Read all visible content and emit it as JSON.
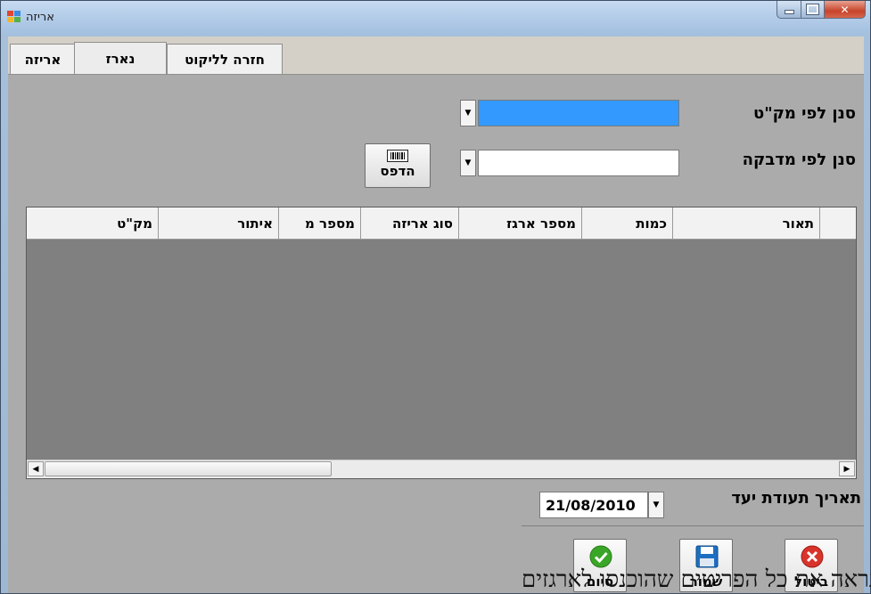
{
  "window": {
    "title": "אריזה"
  },
  "tabs": [
    {
      "label": "אריזה"
    },
    {
      "label": "נארז"
    },
    {
      "label": "חזרה לליקוט"
    }
  ],
  "filters": {
    "by_sku_label": "סנן לפי מק\"ט",
    "by_sticker_label": "סנן לפי מדבקה"
  },
  "print_button": {
    "label": "הדפס",
    "icon": "barcode-icon"
  },
  "grid": {
    "columns": [
      "תאור",
      "כמות",
      "מספר ארגז",
      "סוג אריזה",
      "מספר מ",
      "איתור",
      "מק\"ט"
    ]
  },
  "date_field": {
    "label": "תאריך תעודת יעד",
    "value": "21/08/2010"
  },
  "actions": {
    "cancel": {
      "label": "ביטול",
      "icon": "cancel-x-icon",
      "color": "#d9342b"
    },
    "save": {
      "label": "שמור",
      "icon": "floppy-disk-icon",
      "color": "#1d6fc1"
    },
    "finish": {
      "label": "סיום",
      "icon": "checkmark-icon",
      "color": "#3aa627"
    }
  },
  "overlay_text": "זה נראה את כל הפריטים שהוכנסו לארגזים",
  "colors": {
    "selected_field": "#3399ff",
    "grid_body": "#808080"
  }
}
